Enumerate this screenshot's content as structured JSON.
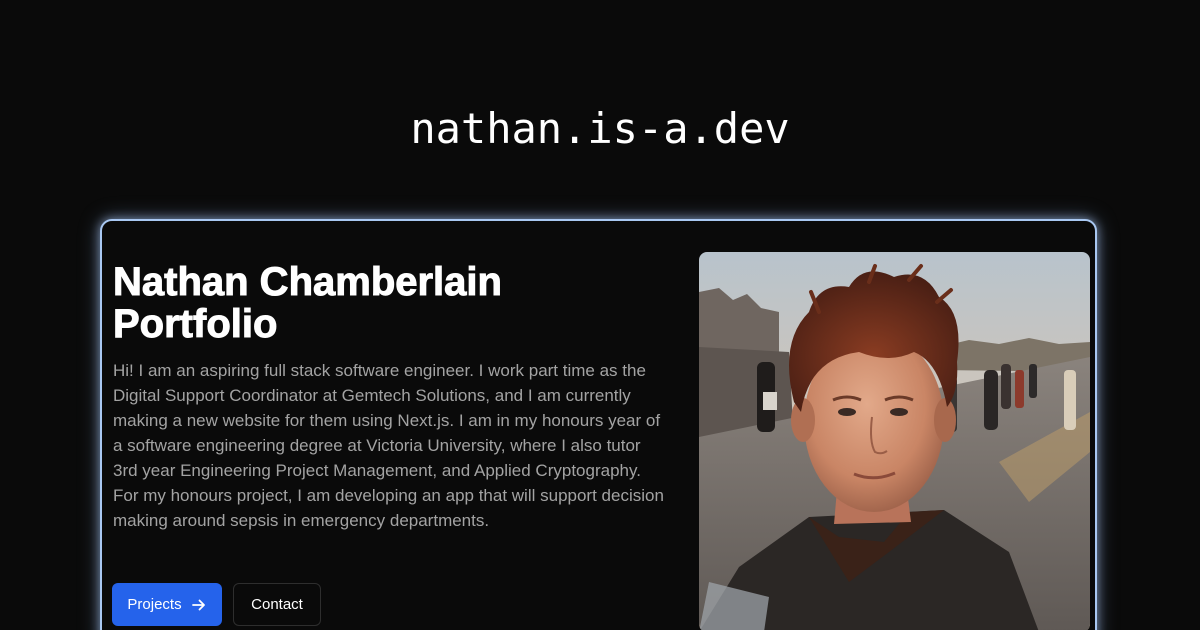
{
  "site": {
    "title": "nathan.is-a.dev"
  },
  "hero": {
    "heading_line1": "Nathan Chamberlain",
    "heading_line2": "Portfolio",
    "bio": "Hi! I am an aspiring full stack software engineer. I work part time as the Digital Support Coordinator at Gemtech Solutions, and I am currently making a new website for them using Next.js. I am in my honours year of a software engineering degree at Victoria University, where I also tutor 3rd year Engineering Project Management, and Applied Cryptography. For my honours project, I am developing an app that will support decision making around sepsis in emergency departments.",
    "projects_label": "Projects",
    "contact_label": "Contact",
    "projects_icon": "arrow-right-icon"
  },
  "colors": {
    "background": "#0a0a0a",
    "card_border": "#a9c8f2",
    "primary_button": "#2563eb",
    "body_text": "#a3a3a3"
  }
}
